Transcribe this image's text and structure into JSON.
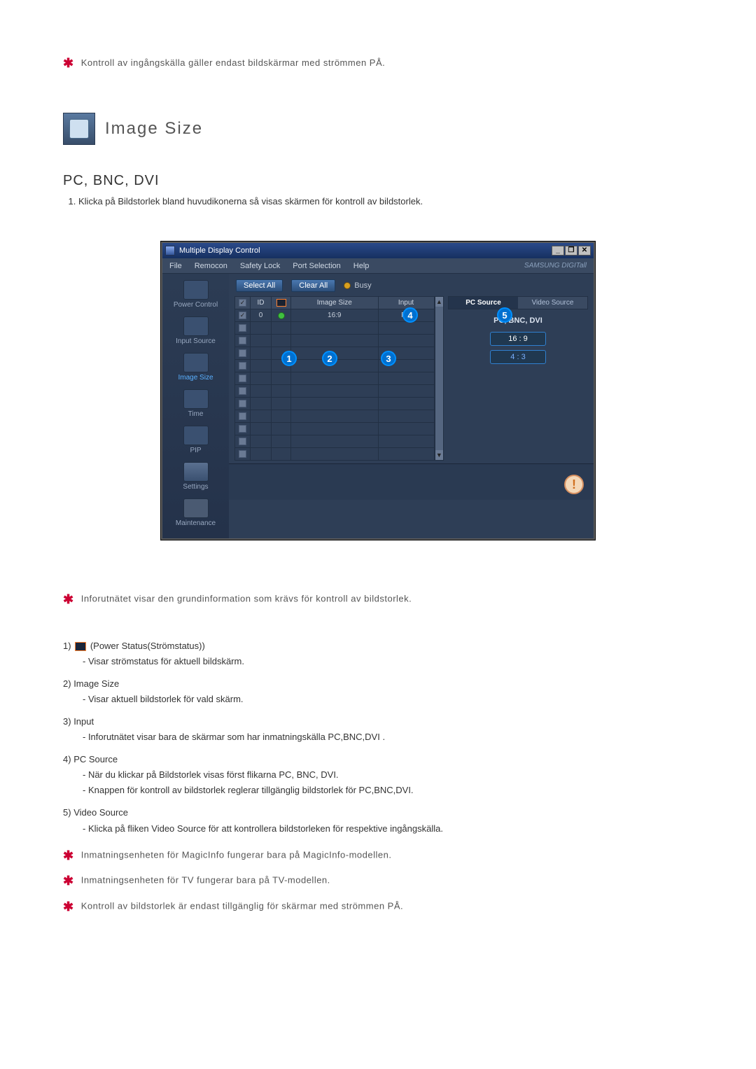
{
  "notes": {
    "top": "Kontroll av ingångskälla gäller endast bildskärmar med strömmen PÅ.",
    "info_grid": "Inforutnätet visar den grundinformation som krävs för kontroll av bildstorlek.",
    "magicinfo": "Inmatningsenheten för MagicInfo fungerar bara på MagicInfo-modellen.",
    "tv": "Inmatningsenheten för TV fungerar bara på TV-modellen.",
    "power_on": "Kontroll av bildstorlek är endast tillgänglig för skärmar med strömmen PÅ."
  },
  "section": {
    "title": "Image Size"
  },
  "subhead": "PC, BNC, DVI",
  "step1": "Klicka på Bildstorlek bland huvudikonerna så visas skärmen för kontroll av bildstorlek.",
  "app": {
    "title": "Multiple Display Control",
    "menus": {
      "file": "File",
      "remocon": "Remocon",
      "safety_lock": "Safety Lock",
      "port_selection": "Port Selection",
      "help": "Help"
    },
    "brand": "SAMSUNG DIGITall",
    "sidebar": {
      "power": "Power Control",
      "input": "Input Source",
      "image": "Image Size",
      "time": "Time",
      "pip": "PIP",
      "settings": "Settings",
      "maintenance": "Maintenance"
    },
    "toolbar": {
      "select_all": "Select All",
      "clear_all": "Clear All",
      "busy": "Busy"
    },
    "columns": {
      "id": "ID",
      "image_size": "Image Size",
      "input": "Input"
    },
    "row0": {
      "id": "0",
      "image_size": "16:9",
      "input": "PC"
    },
    "tabs": {
      "pc_source": "PC Source",
      "video_source": "Video Source"
    },
    "right": {
      "label": "PC, BNC, DVI",
      "btn_169": "16 : 9",
      "btn_43": "4 : 3"
    },
    "win_btns": {
      "min": "_",
      "restore": "❐",
      "close": "✕"
    }
  },
  "callouts": {
    "c1": "1",
    "c2": "2",
    "c3": "3",
    "c4": "4",
    "c5": "5"
  },
  "desc": {
    "n1_label": "1)",
    "n1_title": "(Power Status(Strömstatus))",
    "n1_sub": "- Visar strömstatus för aktuell bildskärm.",
    "n2_label": "2)",
    "n2_title": "Image Size",
    "n2_sub": "- Visar aktuell bildstorlek för vald skärm.",
    "n3_label": "3)",
    "n3_title": "Input",
    "n3_sub": "- Inforutnätet visar bara de skärmar som har inmatningskälla PC,BNC,DVI .",
    "n4_label": "4)",
    "n4_title": "PC Source",
    "n4_sub1": "- När du klickar på Bildstorlek visas först flikarna PC, BNC, DVI.",
    "n4_sub2": "- Knappen för kontroll av bildstorlek reglerar tillgänglig bildstorlek för PC,BNC,DVI.",
    "n5_label": "5)",
    "n5_title": "Video Source",
    "n5_sub": "- Klicka på fliken Video Source för att kontrollera bildstorleken för respektive ingångskälla."
  }
}
